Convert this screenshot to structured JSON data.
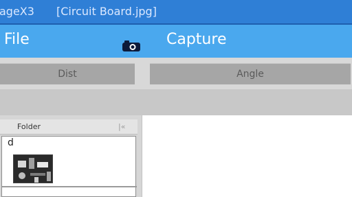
{
  "titlebar": {
    "app_name": "ageX3",
    "document": "[Circuit Board.jpg]"
  },
  "menubar": {
    "file_label": "File",
    "capture_icon": "camera-icon",
    "capture_label": "Capture"
  },
  "toolbar": {
    "dist_label": "Dist",
    "angle_label": "Angle"
  },
  "folder_panel": {
    "header_label": "Folder",
    "collapse_icon_glyph": "|«",
    "tree_item_label": "d",
    "thumbnail": "circuit-board-thumbnail"
  },
  "colors": {
    "titlebar": "#2f7fd6",
    "menubar": "#4aa8ee",
    "button": "#a6a6a6"
  }
}
